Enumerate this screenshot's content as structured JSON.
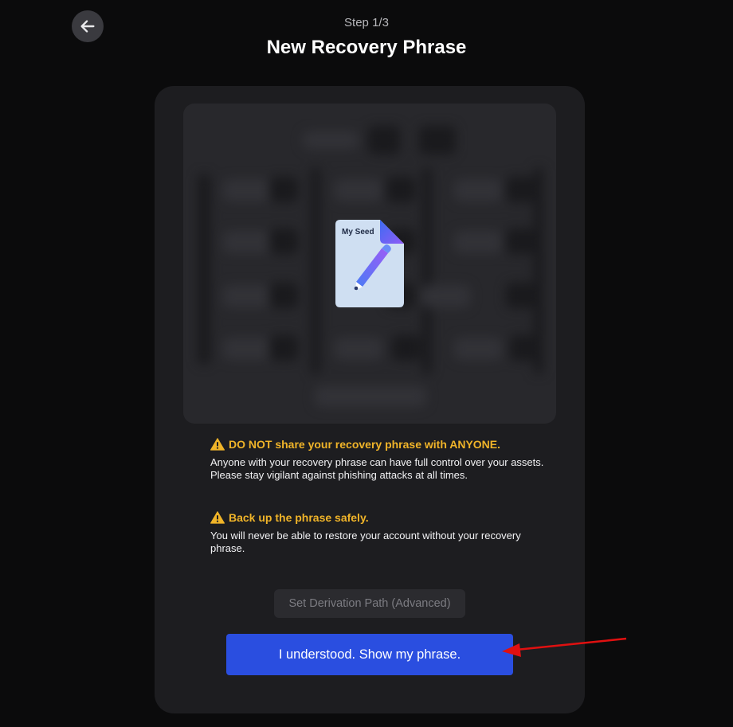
{
  "header": {
    "step": "Step 1/3",
    "title": "New Recovery Phrase",
    "back_icon": "arrow-left-icon"
  },
  "preview": {
    "doc_label": "My Seed",
    "doc_icon": "pencil-icon"
  },
  "warnings": [
    {
      "icon": "warning-icon",
      "heading": "DO NOT share your recovery phrase with ANYONE.",
      "body": "Anyone with your recovery phrase can have full control over your assets. Please stay vigilant against phishing attacks at all times."
    },
    {
      "icon": "warning-icon",
      "heading": "Back up the phrase safely.",
      "body": "You will never be able to restore your account without your recovery phrase."
    }
  ],
  "actions": {
    "derivation_label": "Set Derivation Path (Advanced)",
    "show_phrase_label": "I understood. Show my phrase."
  },
  "colors": {
    "accent": "#2a4ee0",
    "warning": "#f0b429",
    "annotation_arrow": "#e01010"
  }
}
